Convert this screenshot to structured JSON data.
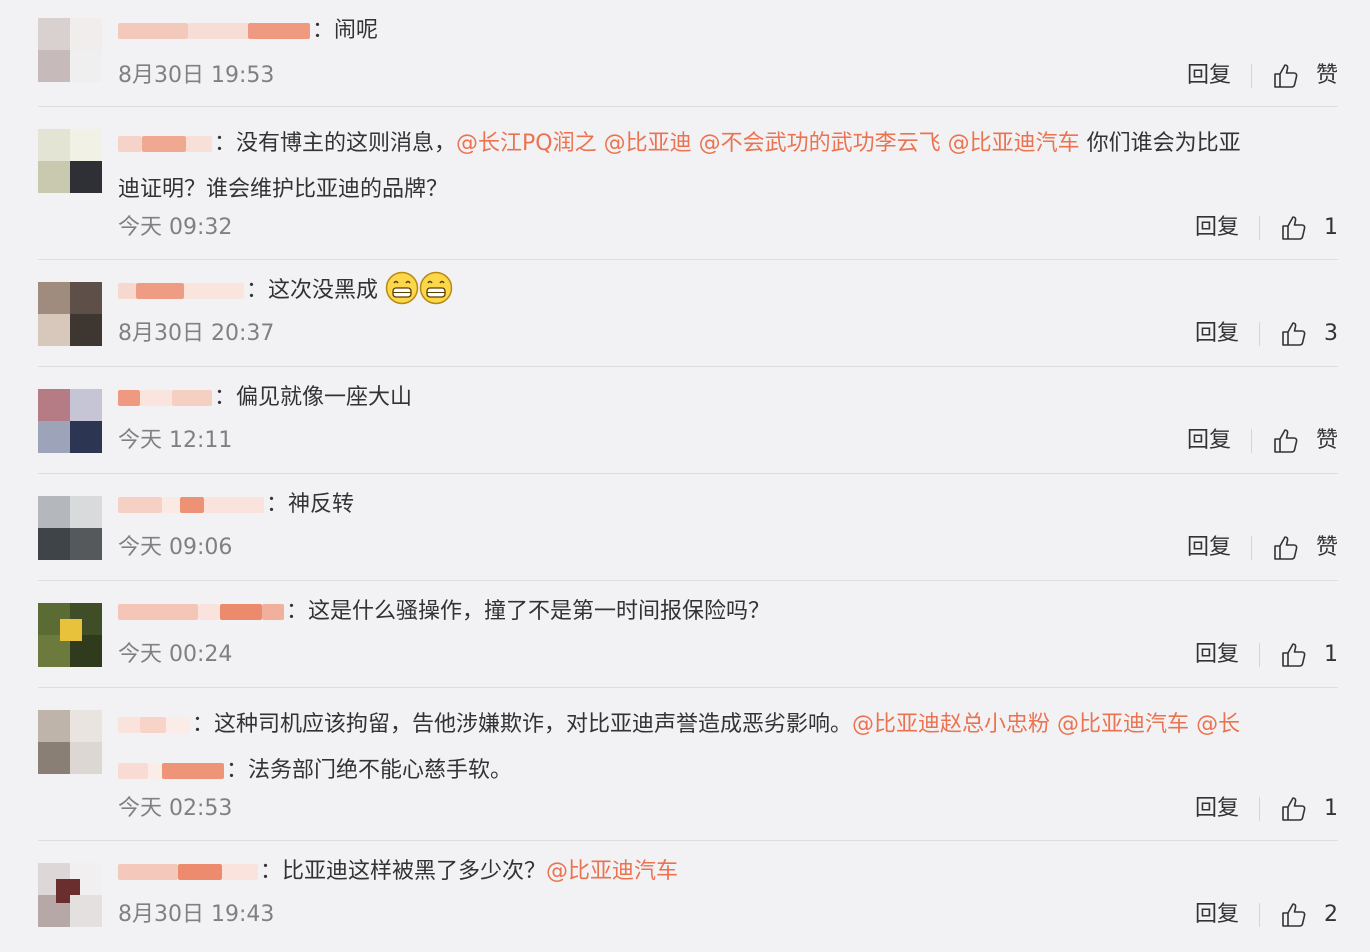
{
  "actions": {
    "reply_label": "回复",
    "like_label_empty": "赞"
  },
  "colors": {
    "mention": "#eb7350",
    "time": "#808080",
    "background": "#f2f2f5"
  },
  "comments": [
    {
      "text": "闹呢",
      "time": "8月30日 19:53",
      "like": "赞"
    },
    {
      "text_a": "没有博主的这则消息，",
      "mention_1": "@长江PQ润之",
      "mention_2": "@比亚迪",
      "mention_3": "@不会武功的武功李云飞",
      "mention_4": "@比亚迪汽车",
      "text_b": " 你们谁会为比亚",
      "text_c": "迪证明？谁会维护比亚迪的品牌？",
      "time": "今天 09:32",
      "like": "1"
    },
    {
      "text": "这次没黑成",
      "emoji": "grin-emoji",
      "time": "8月30日 20:37",
      "like": "3"
    },
    {
      "text": "偏见就像一座大山",
      "time": "今天 12:11",
      "like": "赞"
    },
    {
      "text": "神反转",
      "time": "今天 09:06",
      "like": "赞"
    },
    {
      "text": "这是什么骚操作，撞了不是第一时间报保险吗？",
      "time": "今天 00:24",
      "like": "1"
    },
    {
      "text_a": "这种司机应该拘留，告他涉嫌欺诈，对比亚迪声誉造成恶劣影响。",
      "mention_1": "@比亚迪赵总小忠粉",
      "mention_2": "@比亚迪汽车",
      "mention_3": "@长",
      "text_b": "法务部门绝不能心慈手软。",
      "time": "今天 02:53",
      "like": "1"
    },
    {
      "text": "比亚迪这样被黑了多少次？",
      "mention_1": "@比亚迪汽车",
      "time": "8月30日 19:43",
      "like": "2"
    }
  ]
}
